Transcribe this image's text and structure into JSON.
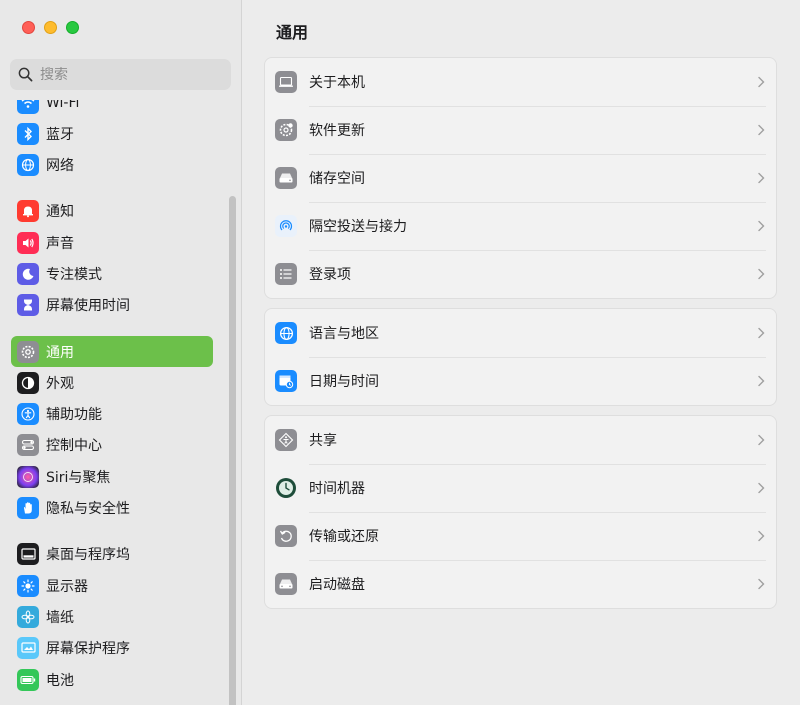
{
  "search": {
    "placeholder": "搜索"
  },
  "sidebar": {
    "items": [
      {
        "label": "Wi-Fi",
        "icon": "wifi-icon",
        "color": "#1a8cff"
      },
      {
        "label": "蓝牙",
        "icon": "bluetooth-icon",
        "color": "#1a8cff"
      },
      {
        "label": "网络",
        "icon": "globe-icon",
        "color": "#1a8cff"
      },
      {
        "label": "通知",
        "icon": "bell-icon",
        "color": "#ff3b30"
      },
      {
        "label": "声音",
        "icon": "speaker-icon",
        "color": "#ff2d55"
      },
      {
        "label": "专注模式",
        "icon": "moon-icon",
        "color": "#5e5ce6"
      },
      {
        "label": "屏幕使用时间",
        "icon": "hourglass-icon",
        "color": "#5e5ce6"
      },
      {
        "label": "通用",
        "icon": "gear-icon",
        "color": "#8e8e93"
      },
      {
        "label": "外观",
        "icon": "appearance-icon",
        "color": "#1d1d1f"
      },
      {
        "label": "辅助功能",
        "icon": "accessibility-icon",
        "color": "#1a8cff"
      },
      {
        "label": "控制中心",
        "icon": "control-center-icon",
        "color": "#8e8e93"
      },
      {
        "label": "Siri与聚焦",
        "icon": "siri-icon",
        "color": "#7b3ff2"
      },
      {
        "label": "隐私与安全性",
        "icon": "hand-icon",
        "color": "#1a8cff"
      },
      {
        "label": "桌面与程序坞",
        "icon": "dock-icon",
        "color": "#1d1d1f"
      },
      {
        "label": "显示器",
        "icon": "sun-icon",
        "color": "#1a8cff"
      },
      {
        "label": "墙纸",
        "icon": "flower-icon",
        "color": "#34aadc"
      },
      {
        "label": "屏幕保护程序",
        "icon": "screensaver-icon",
        "color": "#5ac8fa"
      },
      {
        "label": "电池",
        "icon": "battery-icon",
        "color": "#34c759"
      }
    ]
  },
  "main": {
    "title": "通用",
    "groups": [
      [
        {
          "label": "关于本机",
          "icon": "laptop-icon"
        },
        {
          "label": "软件更新",
          "icon": "gear-badge-icon"
        },
        {
          "label": "储存空间",
          "icon": "drive-icon"
        },
        {
          "label": "隔空投送与接力",
          "icon": "airdrop-icon"
        },
        {
          "label": "登录项",
          "icon": "list-icon"
        }
      ],
      [
        {
          "label": "语言与地区",
          "icon": "globe-icon"
        },
        {
          "label": "日期与时间",
          "icon": "calendar-clock-icon"
        }
      ],
      [
        {
          "label": "共享",
          "icon": "share-icon"
        },
        {
          "label": "时间机器",
          "icon": "time-machine-icon"
        },
        {
          "label": "传输或还原",
          "icon": "restore-icon"
        },
        {
          "label": "启动磁盘",
          "icon": "startup-disk-icon"
        }
      ]
    ]
  }
}
